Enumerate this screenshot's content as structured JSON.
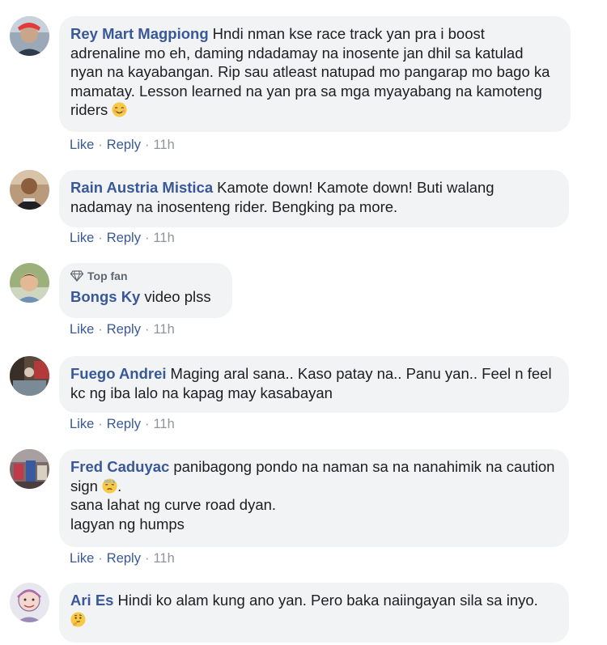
{
  "comments": [
    {
      "author": "Rey Mart Magpiong",
      "text": "Hndi nman kse race track yan pra i boost adrenaline mo eh, daming ndadamay na inosente jan dhil sa katulad nyan na kayabangan. Rip sau atleast natupad mo pangarap mo bago ka mamatay. Lesson learned na yan pra sa mga myayabang na kamoteng riders",
      "emoji": "relieved-face-emoji",
      "like": "Like",
      "reply": "Reply",
      "time": "11h"
    },
    {
      "author": "Rain Austria Mistica",
      "text": "Kamote down! Kamote down! Buti walang nadamay na inosenteng rider. Bengking pa more.",
      "like": "Like",
      "reply": "Reply",
      "time": "11h"
    },
    {
      "badge": "Top fan",
      "author": "Bongs Ky",
      "text": "video plss",
      "like": "Like",
      "reply": "Reply",
      "time": "11h"
    },
    {
      "author": "Fuego Andrei",
      "text": "Maging aral sana.. Kaso patay na.. Panu yan.. Feel n feel kc ng iba lalo na kapag may kasabayan",
      "like": "Like",
      "reply": "Reply",
      "time": "11h"
    },
    {
      "author": "Fred Caduyac",
      "text": "panibagong pondo na naman sa na nanahimik na caution sign",
      "text_after_emoji": ".\nsana lahat ng curve road dyan.\nlagyan ng humps",
      "emoji": "downcast-sweat-face-emoji",
      "like": "Like",
      "reply": "Reply",
      "time": "11h"
    },
    {
      "author": "Ari Es",
      "text": "Hindi ko alam kung ano yan. Pero baka naiingayan sila sa inyo.",
      "emoji": "thinking-face-emoji"
    }
  ],
  "colors": {
    "link": "#385898",
    "bubble": "#f2f3f5",
    "muted": "#90949c"
  }
}
